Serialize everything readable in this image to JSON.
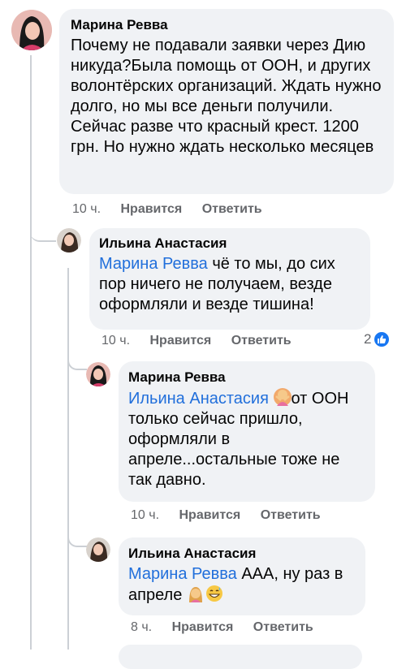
{
  "comments": [
    {
      "author": "Марина Ревва",
      "text": "Почему не подавали заявки через Дию никуда?Была помощь от ООН, и других волонтёрских организаций. Ждать нужно долго, но мы все деньги получили. Сейчас разве что красный крест. 1200 грн. Но нужно ждать несколько месяцев",
      "time": "10 ч.",
      "like": "Нравится",
      "reply": "Ответить"
    },
    {
      "author": "Ильина Анастасия",
      "mention": "Марина Ревва",
      "text": " чё то мы, до сих пор ничего не получаем, везде оформляли и везде тишина!",
      "time": "10 ч.",
      "like": "Нравится",
      "reply": "Ответить",
      "reaction_count": "2"
    },
    {
      "author": "Марина Ревва",
      "mention": "Ильина Анастасия",
      "text": "от ООН только сейчас пришло, оформляли в апреле...остальные тоже не так давно.",
      "time": "10 ч.",
      "like": "Нравится",
      "reply": "Ответить"
    },
    {
      "author": "Ильина Анастасия",
      "mention": "Марина Ревва",
      "text": " ААА, ну раз в апреле",
      "time": "8 ч.",
      "like": "Нравится",
      "reply": "Ответить"
    }
  ],
  "icons": {
    "reaction": "like-icon",
    "emoji_1": "person-gesturing-no-emoji",
    "emoji_2": "person-facepalming-emoji",
    "emoji_3": "grinning-sweat-emoji"
  },
  "colors": {
    "bubble": "#f0f2f5",
    "mention": "#216fdb",
    "meta": "#65676b",
    "like": "#1877f2"
  }
}
